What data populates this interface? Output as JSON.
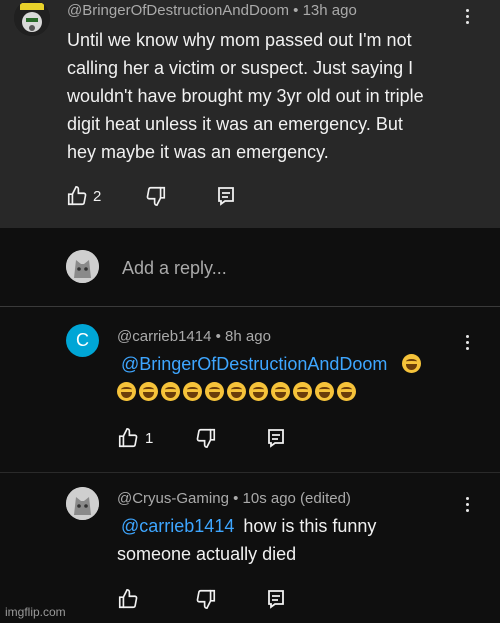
{
  "comment_top": {
    "author": "@BringerOfDestructionAndDoom",
    "time": "13h ago",
    "text_lines": [
      "Until we know why mom passed out I'm not",
      "calling her a victim or suspect. Just saying I",
      "wouldn't have brought my 3yr old out in triple",
      "digit heat unless it was an emergency. But",
      "hey maybe it was an emergency."
    ],
    "likes": "2"
  },
  "reply_box": {
    "placeholder": "Add a reply..."
  },
  "reply_1": {
    "avatar_letter": "C",
    "author": "@carrieb1414",
    "time": "8h ago",
    "mention": "@BringerOfDestructionAndDoom",
    "likes": "1"
  },
  "reply_2": {
    "author": "@Cryus-Gaming",
    "time": "10s ago (edited)",
    "mention": "@carrieb1414",
    "text_after_mention": "how is this funny",
    "text_line2": "someone actually died"
  },
  "colors": {
    "accent_link": "#3ea6ff",
    "avatar_c_bg": "#00a6d6"
  },
  "icons": [
    "thumb-up-icon",
    "thumb-down-icon",
    "reply-icon",
    "more-vert-icon"
  ],
  "watermark": "imgflip.com"
}
